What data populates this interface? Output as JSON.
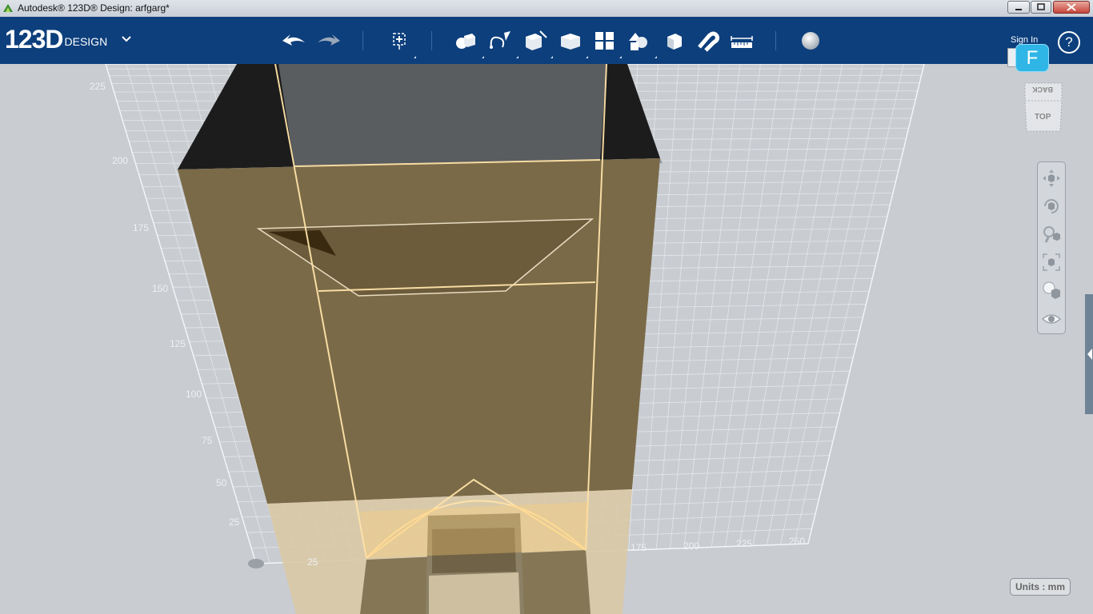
{
  "window": {
    "title": "Autodesk® 123D® Design: arfgarg*"
  },
  "toolbar": {
    "logo_main": "123D",
    "logo_sub": "DESIGN",
    "sign_in": "Sign In",
    "help": "?",
    "user_badge": "F",
    "tools": [
      "undo-icon",
      "redo-icon",
      "transform-icon",
      "primitives-icon",
      "sketch-icon",
      "construct-icon",
      "modify-icon",
      "pattern-icon",
      "grouping-icon",
      "combine-icon",
      "snap-icon",
      "measure-icon",
      "material-icon"
    ]
  },
  "viewcube": {
    "top_label": "TOP",
    "back_label": "BACK"
  },
  "grid_labels": {
    "vertical": [
      "225",
      "200",
      "175",
      "150",
      "125",
      "100",
      "75",
      "50",
      "25"
    ],
    "horizontal": [
      "25",
      "175",
      "200",
      "225",
      "250"
    ]
  },
  "status": {
    "units": "Units : mm"
  },
  "colors": {
    "toolbar_bg": "#0d3f7c",
    "viewport_bg": "#c9ccd1",
    "badge": "#2fb6e6",
    "model_face": "#7a6a48"
  }
}
